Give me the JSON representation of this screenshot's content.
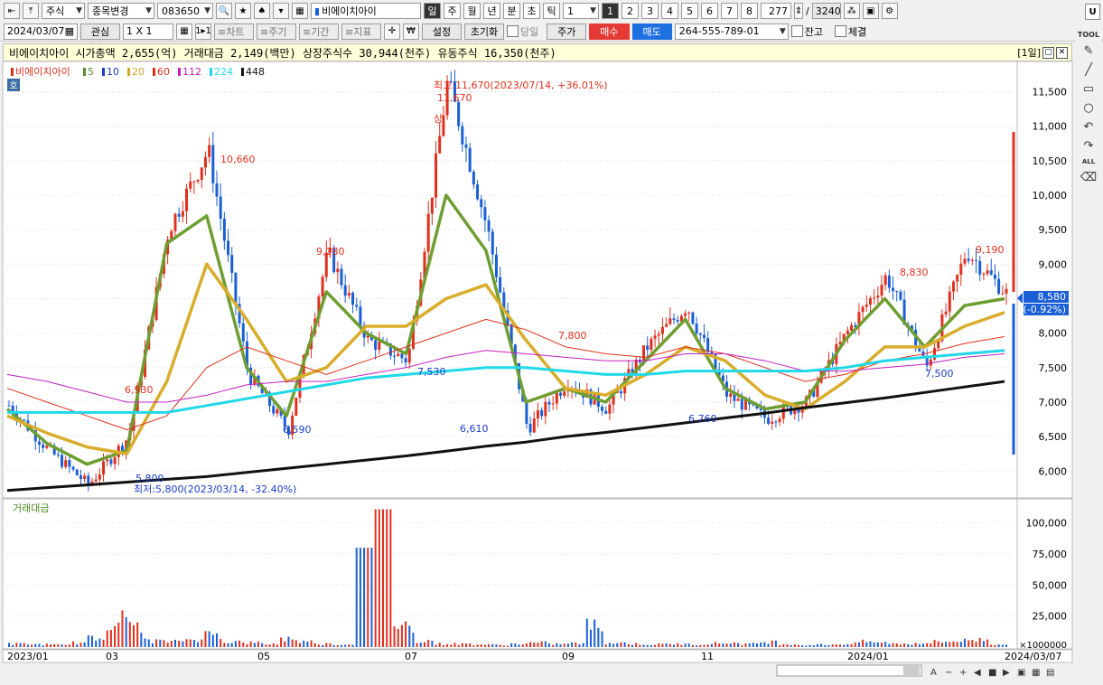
{
  "toolbar": {
    "market": "주식",
    "change_label": "종목변경",
    "code": "083650",
    "name": "비에이치아이",
    "periods": [
      "일",
      "주",
      "월",
      "년",
      "분",
      "초",
      "틱"
    ],
    "period_value": "1",
    "nums": [
      "1",
      "2",
      "3",
      "4",
      "5",
      "6",
      "7",
      "8"
    ],
    "count": "277",
    "total": "3240",
    "date": "2024/03/07",
    "fav": "관심",
    "grid": "1 X 1",
    "grid2": "1▸1",
    "tabs": [
      "≡차트",
      "≡주기",
      "≡기간",
      "≡지표"
    ],
    "setting": "설정",
    "reset": "초기화",
    "today": "당일",
    "price_btn": "주가",
    "buy": "매수",
    "sell": "매도",
    "account": "264-555-789-01",
    "balance": "잔고",
    "fill": "체결",
    "u_btn": "U",
    "tool_label": "TOOL",
    "all_label": "ALL"
  },
  "infobar": {
    "text": "비에이치아이  시가총액 2,655(억)  거래대금 2,149(백만)  상장주식수 30,944(천주)  유동주식 16,350(천주)",
    "tag": "[1일]"
  },
  "chart_data": {
    "type": "candlestick",
    "symbol": "비에이치아이",
    "legend": [
      "비에이치아이",
      "5",
      "10",
      "20",
      "60",
      "112",
      "224",
      "448"
    ],
    "legend_colors": [
      "#e0301e",
      "#5a8a2a",
      "#1a3cc8",
      "#d4a72c",
      "#e0301e",
      "#c020c0",
      "#20d8e8",
      "#111111"
    ],
    "hoga_tag": "호",
    "y_ticks": [
      11500,
      11000,
      10500,
      10000,
      9500,
      9000,
      8500,
      8000,
      7500,
      7000,
      6500,
      6000
    ],
    "y_range": [
      5650,
      11900
    ],
    "x_ticks": [
      "2023/01",
      "03",
      "05",
      "07",
      "09",
      "11",
      "2024/01",
      "2024/03/07"
    ],
    "price_path": [
      [
        "2023/01",
        6950
      ],
      [
        "2023/02",
        6300
      ],
      [
        "2023/03/14",
        5800
      ],
      [
        "2023/03",
        6500
      ],
      [
        "2023/04",
        9500
      ],
      [
        "2023/04",
        10660
      ],
      [
        "2023/05",
        7400
      ],
      [
        "2023/05",
        6590
      ],
      [
        "2023/06",
        9180
      ],
      [
        "2023/06",
        7900
      ],
      [
        "2023/07",
        7600
      ],
      [
        "2023/07/14",
        11670
      ],
      [
        "2023/07",
        9500
      ],
      [
        "2023/08",
        6610
      ],
      [
        "2023/08",
        7300
      ],
      [
        "2023/09",
        6900
      ],
      [
        "2023/10",
        7800
      ],
      [
        "2023/10",
        8400
      ],
      [
        "2023/11",
        7100
      ],
      [
        "2023/11",
        6760
      ],
      [
        "2023/12",
        7000
      ],
      [
        "2024/01",
        8000
      ],
      [
        "2024/01",
        8830
      ],
      [
        "2024/02",
        7500
      ],
      [
        "2024/02",
        9190
      ],
      [
        "2024/03/07",
        8580
      ]
    ],
    "ma": {
      "5": [
        6900,
        6400,
        6100,
        6300,
        9300,
        9700,
        7500,
        6800,
        8600,
        8000,
        7700,
        10000,
        9200,
        7000,
        7200,
        7000,
        7600,
        8200,
        7200,
        6900,
        7000,
        7900,
        8500,
        7800,
        8400,
        8500
      ],
      "20": [
        6800,
        6550,
        6350,
        6250,
        7300,
        9000,
        8200,
        7300,
        7500,
        8100,
        8100,
        8500,
        8700,
        7900,
        7200,
        7100,
        7400,
        7800,
        7600,
        7100,
        6900,
        7300,
        7800,
        7800,
        8100,
        8300
      ],
      "60": [
        7200,
        7000,
        6800,
        6600,
        6800,
        7500,
        7800,
        7600,
        7400,
        7600,
        7800,
        8000,
        8200,
        8050,
        7800,
        7700,
        7650,
        7800,
        7700,
        7500,
        7300,
        7400,
        7600,
        7700,
        7850,
        7950
      ],
      "112": [
        7400,
        7300,
        7150,
        7000,
        7000,
        7100,
        7250,
        7300,
        7300,
        7400,
        7500,
        7650,
        7750,
        7700,
        7650,
        7600,
        7600,
        7700,
        7700,
        7600,
        7450,
        7450,
        7500,
        7550,
        7650,
        7700
      ],
      "224": [
        6850,
        6850,
        6850,
        6850,
        6850,
        6950,
        7050,
        7150,
        7250,
        7350,
        7400,
        7450,
        7500,
        7500,
        7450,
        7400,
        7400,
        7450,
        7450,
        7450,
        7450,
        7500,
        7600,
        7650,
        7700,
        7750
      ],
      "448": [
        5720,
        5760,
        5800,
        5840,
        5880,
        5920,
        5980,
        6040,
        6100,
        6160,
        6220,
        6290,
        6360,
        6420,
        6500,
        6560,
        6630,
        6700,
        6770,
        6840,
        6920,
        6990,
        7060,
        7140,
        7220,
        7300
      ]
    },
    "annotations": [
      {
        "text": "최고:11,670(2023/07/14, +36.01%)",
        "color": "#e0301e"
      },
      {
        "text": "11,670",
        "color": "#e0301e"
      },
      {
        "text": "10,660",
        "color": "#e0301e"
      },
      {
        "text": "9,180",
        "color": "#e0301e"
      },
      {
        "text": "6,930",
        "color": "#e0301e"
      },
      {
        "text": "7,800",
        "color": "#e0301e"
      },
      {
        "text": "8,830",
        "color": "#e0301e"
      },
      {
        "text": "9,190",
        "color": "#e0301e"
      },
      {
        "text": "7,530",
        "color": "#1a3cc8"
      },
      {
        "text": "6,590",
        "color": "#1a3cc8"
      },
      {
        "text": "6,610",
        "color": "#1a3cc8"
      },
      {
        "text": "6,760",
        "color": "#1a3cc8"
      },
      {
        "text": "7,500",
        "color": "#1a3cc8"
      },
      {
        "text": "5,800",
        "color": "#1a3cc8"
      },
      {
        "text": "최저:5,800(2023/03/14, -32.40%)",
        "color": "#1a3cc8"
      },
      {
        "text": "상",
        "color": "#e0301e"
      }
    ],
    "current_price": "8,580",
    "current_change": "(-0.92%)",
    "volume": {
      "label": "거래대금",
      "y_ticks": [
        "100,000",
        "75,000",
        "50,000",
        "25,000"
      ],
      "unit": "×1000000",
      "y_range": [
        0,
        115000
      ],
      "values": [
        3000,
        2500,
        2000,
        4000,
        8000,
        26000,
        22000,
        6000,
        5000,
        7000,
        12000,
        5000,
        4000,
        3000,
        8000,
        5000,
        3000,
        2500,
        80000,
        111000,
        20000,
        6000,
        3000,
        3000,
        2500,
        2000,
        3000,
        4000,
        3000,
        3500,
        20000,
        4000,
        3000,
        2500,
        3000,
        2500,
        3500,
        4000,
        3000,
        5000,
        3000,
        2000,
        2500,
        3000,
        5000,
        4000,
        3000,
        4000,
        5000,
        6000,
        7000,
        3000
      ]
    }
  },
  "colors": {
    "up": "#e0301e",
    "down": "#1a5fd6",
    "grid": "#d8d8d8"
  }
}
